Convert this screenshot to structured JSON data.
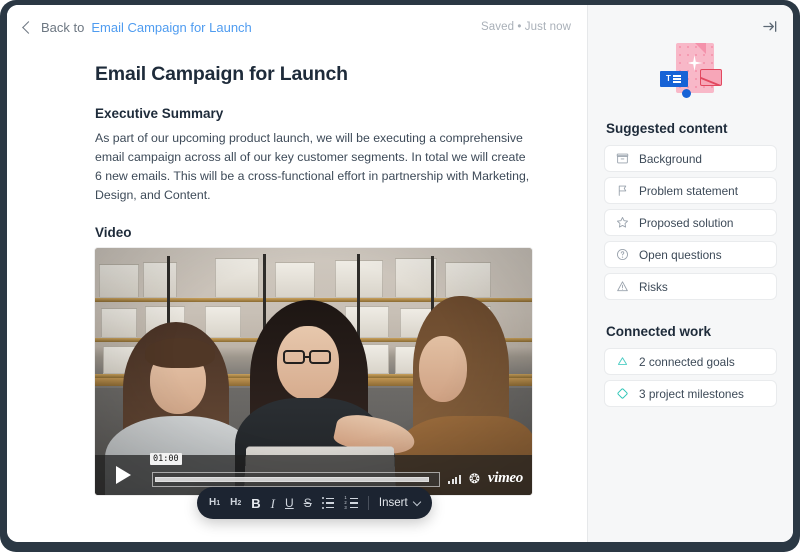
{
  "topbar": {
    "back_label": "Back to",
    "back_title": "Email Campaign for Launch",
    "saved_status": "Saved • Just now",
    "collapse_icon": "collapse-panel-icon"
  },
  "document": {
    "title": "Email Campaign for Launch",
    "sections": [
      {
        "heading": "Executive Summary",
        "body": "As part of our upcoming product launch, we will be executing a comprehensive email campaign across all of our key customer segments. In total we will create 6 new emails. This will be a cross-functional effort in partnership with Marketing, Design, and Content."
      },
      {
        "heading": "Video",
        "body": ""
      }
    ]
  },
  "video": {
    "duration": "01:00",
    "provider": "vimeo",
    "play_icon": "play-icon",
    "volume_icon": "volume-icon",
    "settings_icon": "gear-icon"
  },
  "toolbar": {
    "items": [
      {
        "label": "H",
        "sub": "1",
        "name": "heading-1-button"
      },
      {
        "label": "H",
        "sub": "2",
        "name": "heading-2-button"
      },
      {
        "label": "B",
        "name": "bold-button"
      },
      {
        "label": "I",
        "name": "italic-button"
      },
      {
        "label": "U",
        "name": "underline-button"
      },
      {
        "label": "S",
        "name": "strikethrough-button"
      }
    ],
    "bulleted_list": "bulleted-list-icon",
    "numbered_list": "numbered-list-icon",
    "insert_label": "Insert"
  },
  "sidebar": {
    "illustration": "suggested-content-illustration",
    "suggested": {
      "title": "Suggested content",
      "items": [
        {
          "label": "Background",
          "icon": "archive-box-icon"
        },
        {
          "label": "Problem statement",
          "icon": "flag-icon"
        },
        {
          "label": "Proposed solution",
          "icon": "star-icon"
        },
        {
          "label": "Open questions",
          "icon": "question-circle-icon"
        },
        {
          "label": "Risks",
          "icon": "warning-triangle-icon"
        }
      ]
    },
    "connected": {
      "title": "Connected work",
      "items": [
        {
          "label": "2 connected goals",
          "icon": "goal-triangle-icon",
          "color": "#4ecdc4"
        },
        {
          "label": "3 project milestones",
          "icon": "milestone-diamond-icon",
          "color": "#2fc6b7"
        }
      ]
    }
  },
  "colors": {
    "link": "#4f9cf0",
    "frame": "#2b3844",
    "sidebar_bg": "#f6f7f8",
    "toolbar_bg": "#1c2431",
    "text": "#1e2b3a"
  }
}
